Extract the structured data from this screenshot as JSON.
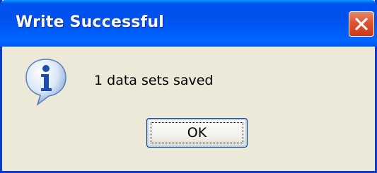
{
  "dialog": {
    "title": "Write Successful",
    "message": "1 data sets saved",
    "ok_label": "OK",
    "icon": "info-icon",
    "close_icon": "close-icon"
  },
  "colors": {
    "titlebar": "#0054e3",
    "frame": "#0a3cc8",
    "body": "#ece9d8",
    "close_button": "#e0532f"
  }
}
